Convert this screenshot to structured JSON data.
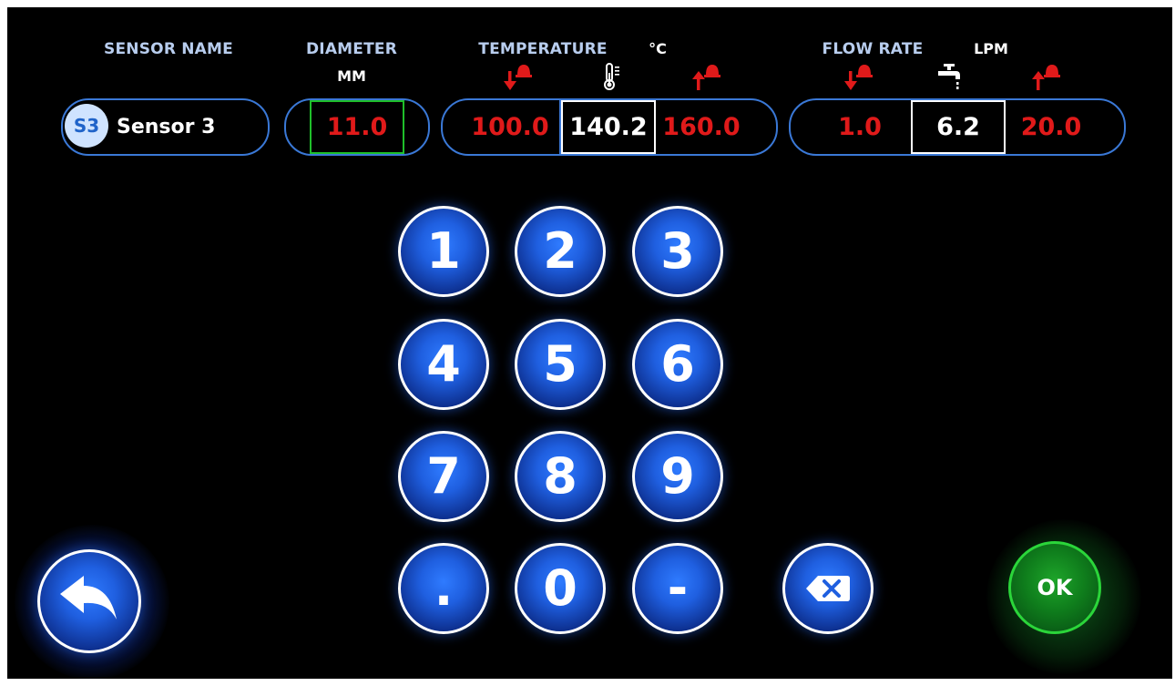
{
  "headers": {
    "sensor_name": "SENSOR NAME",
    "diameter": "DIAMETER",
    "diameter_unit": "MM",
    "temperature": "TEMPERATURE",
    "temperature_unit": "°C",
    "flow_rate": "FLOW RATE",
    "flow_rate_unit": "LPM"
  },
  "sensor": {
    "badge": "S3",
    "name": "Sensor 3"
  },
  "diameter": {
    "value": "11.0"
  },
  "temperature": {
    "low_alarm": "100.0",
    "current": "140.2",
    "high_alarm": "160.0"
  },
  "flow_rate": {
    "low_alarm": "1.0",
    "current": "6.2",
    "high_alarm": "20.0"
  },
  "keypad": {
    "k1": "1",
    "k2": "2",
    "k3": "3",
    "k4": "4",
    "k5": "5",
    "k6": "6",
    "k7": "7",
    "k8": "8",
    "k9": "9",
    "kdot": ".",
    "k0": "0",
    "kminus": "-"
  },
  "actions": {
    "ok": "OK"
  },
  "icons": {
    "low_alarm": "arrow-down-alarm-icon",
    "high_alarm": "arrow-up-alarm-icon",
    "thermometer": "thermometer-icon",
    "faucet": "faucet-icon",
    "backspace": "backspace-icon",
    "back": "back-arrow-icon"
  },
  "colors": {
    "background": "#000000",
    "accent": "#3a78d6",
    "alarm": "#e01a1a",
    "ok": "#1fbf2a",
    "header": "#b8cdee"
  }
}
